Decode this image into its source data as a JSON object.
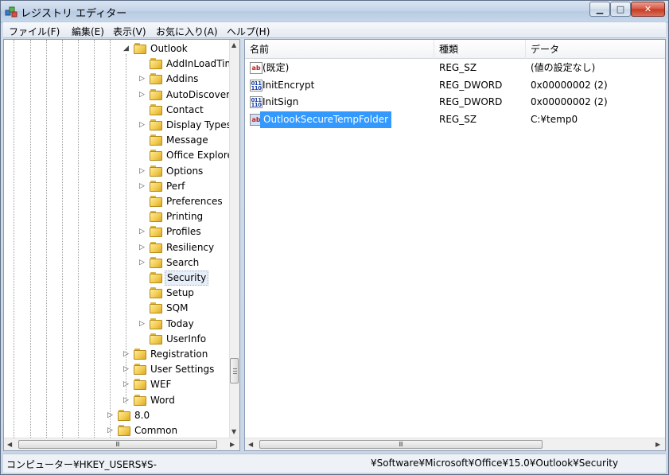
{
  "window": {
    "title": "レジストリ エディター",
    "min_label": "▁",
    "max_label": "□",
    "close_label": "✕"
  },
  "menu": [
    {
      "label": "ファイル(F)"
    },
    {
      "label": "編集(E)"
    },
    {
      "label": "表示(V)"
    },
    {
      "label": "お気に入り(A)"
    },
    {
      "label": "ヘルプ(H)"
    }
  ],
  "tree": {
    "nodes": [
      {
        "label": "Outlook",
        "level": 2,
        "expander": "◢"
      },
      {
        "label": "AddInLoadTim",
        "level": 3,
        "expander": ""
      },
      {
        "label": "Addins",
        "level": 3,
        "expander": "▷"
      },
      {
        "label": "AutoDiscover",
        "level": 3,
        "expander": "▷"
      },
      {
        "label": "Contact",
        "level": 3,
        "expander": ""
      },
      {
        "label": "Display Types",
        "level": 3,
        "expander": "▷"
      },
      {
        "label": "Message",
        "level": 3,
        "expander": ""
      },
      {
        "label": "Office Explorer",
        "level": 3,
        "expander": ""
      },
      {
        "label": "Options",
        "level": 3,
        "expander": "▷"
      },
      {
        "label": "Perf",
        "level": 3,
        "expander": "▷"
      },
      {
        "label": "Preferences",
        "level": 3,
        "expander": ""
      },
      {
        "label": "Printing",
        "level": 3,
        "expander": ""
      },
      {
        "label": "Profiles",
        "level": 3,
        "expander": "▷"
      },
      {
        "label": "Resiliency",
        "level": 3,
        "expander": "▷"
      },
      {
        "label": "Search",
        "level": 3,
        "expander": "▷"
      },
      {
        "label": "Security",
        "level": 3,
        "expander": "",
        "selected": true
      },
      {
        "label": "Setup",
        "level": 3,
        "expander": ""
      },
      {
        "label": "SQM",
        "level": 3,
        "expander": ""
      },
      {
        "label": "Today",
        "level": 3,
        "expander": "▷"
      },
      {
        "label": "UserInfo",
        "level": 3,
        "expander": ""
      },
      {
        "label": "Registration",
        "level": 2,
        "expander": "▷"
      },
      {
        "label": "User Settings",
        "level": 2,
        "expander": "▷"
      },
      {
        "label": "WEF",
        "level": 2,
        "expander": "▷"
      },
      {
        "label": "Word",
        "level": 2,
        "expander": "▷"
      },
      {
        "label": "8.0",
        "level": 1,
        "expander": "▷"
      },
      {
        "label": "Common",
        "level": 1,
        "expander": "▷"
      }
    ],
    "scroll_arrows": {
      "up": "▲",
      "down": "▼",
      "left": "◀",
      "right": "▶",
      "grip": "Ⅲ"
    }
  },
  "list": {
    "columns": {
      "name": "名前",
      "type": "種類",
      "data": "データ"
    },
    "rows": [
      {
        "icon": "string-value-icon",
        "icon_text": "ab",
        "name": "(既定)",
        "type": "REG_SZ",
        "data": "(値の設定なし)"
      },
      {
        "icon": "dword-value-icon",
        "icon_text": "011\n110",
        "name": "InitEncrypt",
        "type": "REG_DWORD",
        "data": "0x00000002 (2)"
      },
      {
        "icon": "dword-value-icon",
        "icon_text": "011\n110",
        "name": "InitSign",
        "type": "REG_DWORD",
        "data": "0x00000002 (2)"
      },
      {
        "icon": "string-value-icon",
        "icon_text": "ab",
        "name": "OutlookSecureTempFolder",
        "type": "REG_SZ",
        "data": "C:¥temp0",
        "selected": true
      }
    ]
  },
  "status": {
    "left": "コンピューター¥HKEY_USERS¥S-",
    "right": "¥Software¥Microsoft¥Office¥15.0¥Outlook¥Security"
  },
  "colors": {
    "selection": "#3399ff",
    "folder": "#f1c94b"
  }
}
